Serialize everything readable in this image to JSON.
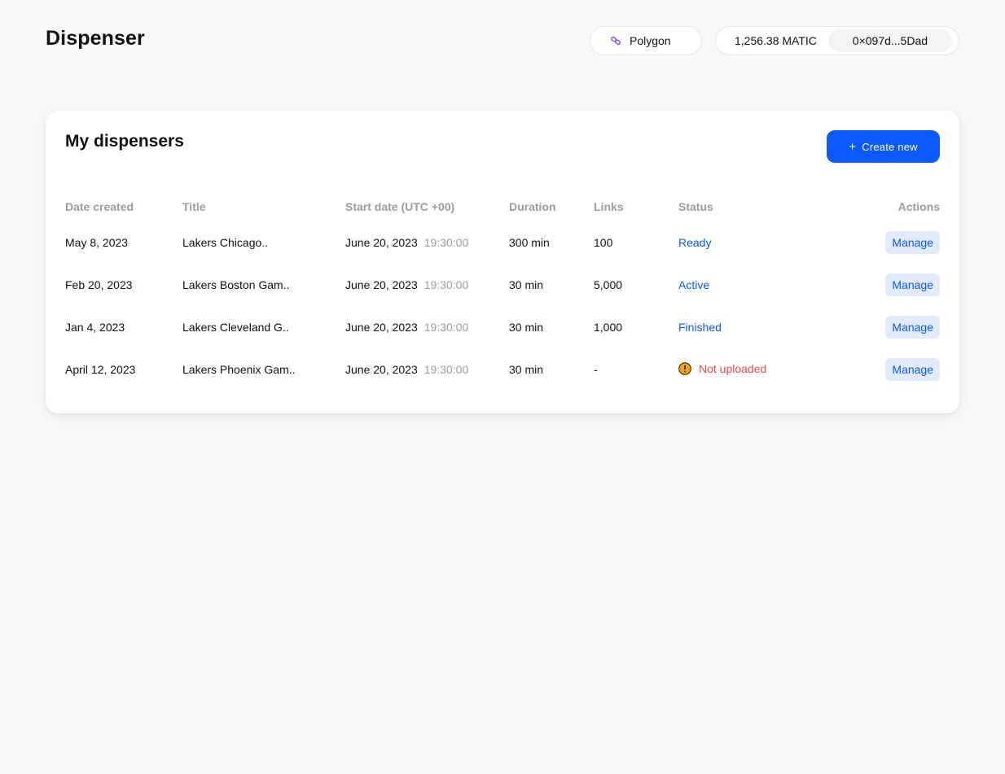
{
  "header": {
    "brand": "Dispenser",
    "network": {
      "label": "Polygon",
      "icon": "polygon-link-icon"
    },
    "wallet": {
      "balance": "1,256.38 MATIC",
      "address": "0×097d...5Dad"
    }
  },
  "card": {
    "title": "My dispensers",
    "create_label": "Create new",
    "columns": {
      "date": "Date created",
      "title": "Title",
      "start": "Start date (UTC +00)",
      "duration": "Duration",
      "links": "Links",
      "status": "Status",
      "actions": "Actions"
    },
    "rows": [
      {
        "date": "May 8, 2023",
        "title": "Lakers Chicago..",
        "start_date": "June 20, 2023",
        "start_time": "19:30:00",
        "duration": "300 min",
        "links": "100",
        "status": "Ready",
        "action": "Manage"
      },
      {
        "date": "Feb 20, 2023",
        "title": "Lakers Boston Gam..",
        "start_date": "June 20, 2023",
        "start_time": "19:30:00",
        "duration": "30 min",
        "links": "5,000",
        "status": "Active",
        "action": "Manage"
      },
      {
        "date": "Jan 4, 2023",
        "title": "Lakers Cleveland G..",
        "start_date": "June 20, 2023",
        "start_time": "19:30:00",
        "duration": "30 min",
        "links": "1,000",
        "status": "Finished",
        "action": "Manage"
      },
      {
        "date": "April 12, 2023",
        "title": "Lakers Phoenix Gam..",
        "start_date": "June 20, 2023",
        "start_time": "19:30:00",
        "duration": "30 min",
        "links": "-",
        "status": "Not uploaded",
        "action": "Manage"
      }
    ]
  },
  "colors": {
    "accent": "#0b59ff",
    "error": "#f04a4a",
    "warning": "#f5a300",
    "muted": "#9a9ca3",
    "background": "#f7f8fa"
  }
}
